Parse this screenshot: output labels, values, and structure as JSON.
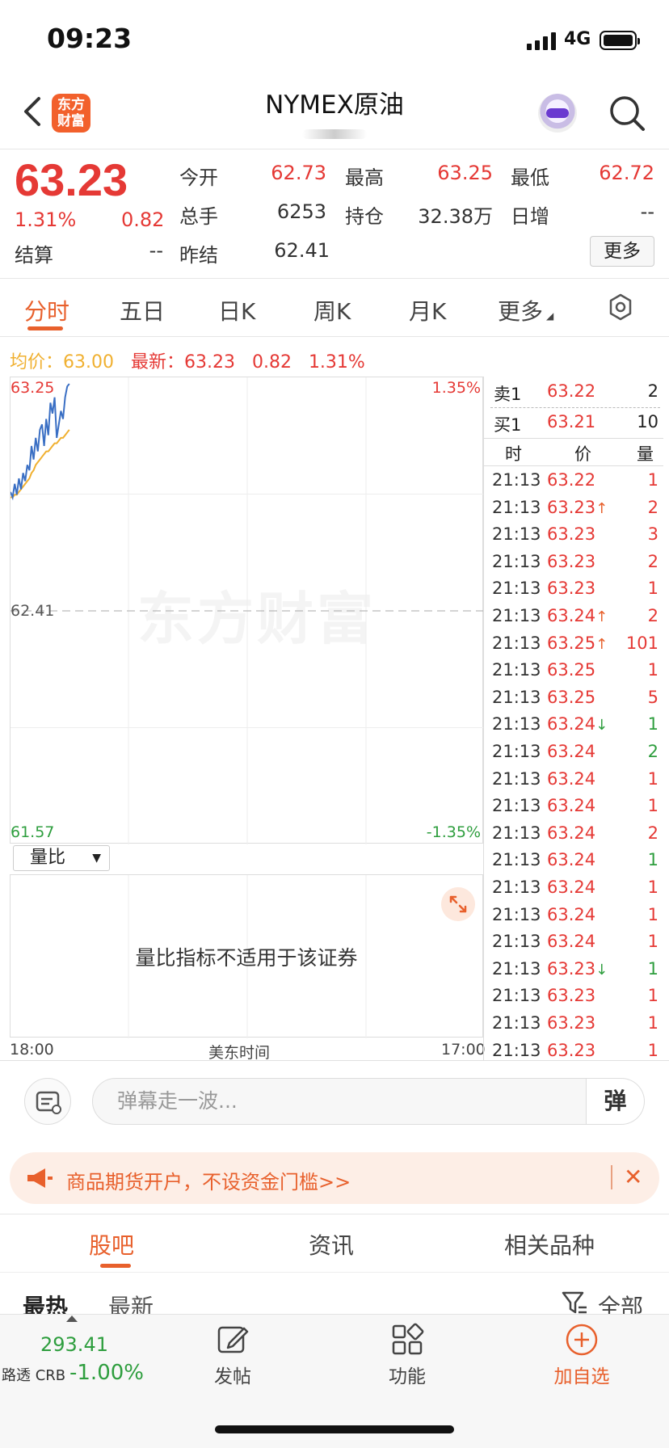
{
  "status": {
    "time": "09:23",
    "network": "4G"
  },
  "header": {
    "title": "NYMEX原油",
    "logo_text_line1": "东方",
    "logo_text_line2": "财富"
  },
  "quote": {
    "price": "63.23",
    "change_pct": "1.31%",
    "change": "0.82",
    "fields": [
      {
        "label": "今开",
        "value": "62.73",
        "color": "#e53935"
      },
      {
        "label": "最高",
        "value": "63.25",
        "color": "#e53935"
      },
      {
        "label": "最低",
        "value": "62.72",
        "color": "#e53935"
      },
      {
        "label": "总手",
        "value": "6253",
        "color": "#333333"
      },
      {
        "label": "持仓",
        "value": "32.38万",
        "color": "#333333"
      },
      {
        "label": "日增",
        "value": "--",
        "color": "#333333"
      },
      {
        "label": "结算",
        "value": "--",
        "color": "#333333"
      },
      {
        "label": "昨结",
        "value": "62.41",
        "color": "#333333"
      }
    ],
    "more_label": "更多"
  },
  "tabs": [
    {
      "label": "分时",
      "active": true
    },
    {
      "label": "五日",
      "active": false
    },
    {
      "label": "日K",
      "active": false
    },
    {
      "label": "周K",
      "active": false
    },
    {
      "label": "月K",
      "active": false
    },
    {
      "label": "更多",
      "active": false
    }
  ],
  "avg_line": {
    "avg_label": "均价：",
    "avg_value": "63.00",
    "latest_label": "最新：",
    "latest_value": "63.23",
    "latest_change": "0.82",
    "latest_pct": "1.31%"
  },
  "chart_data": {
    "type": "line",
    "y_top": "63.25",
    "y_mid": "62.41",
    "y_bottom": "61.57",
    "pct_top": "1.35%",
    "pct_bottom": "-1.35%",
    "ylim": [
      61.57,
      63.25
    ],
    "x_start": "18:00",
    "x_end": "17:00",
    "x_label": "美东时间",
    "watermark": "东方财富",
    "series": [
      {
        "name": "price",
        "color": "#3a6fc4",
        "values": [
          62.85,
          62.83,
          62.88,
          62.84,
          62.9,
          62.86,
          62.92,
          62.89,
          62.95,
          62.93,
          63.02,
          62.97,
          63.05,
          63.0,
          63.08,
          63.1,
          63.02,
          63.12,
          63.06,
          63.18,
          63.14,
          63.2,
          63.05,
          63.1,
          63.15,
          63.12,
          63.2,
          63.24,
          63.25
        ]
      },
      {
        "name": "avg",
        "color": "#f0b030",
        "values": [
          62.83,
          62.83,
          62.84,
          62.84,
          62.85,
          62.86,
          62.87,
          62.88,
          62.89,
          62.9,
          62.92,
          62.93,
          62.95,
          62.96,
          62.97,
          62.98,
          62.99,
          63.0,
          63.0,
          63.01,
          63.02,
          63.03,
          63.03,
          63.04,
          63.05,
          63.05,
          63.06,
          63.07,
          63.08
        ]
      }
    ]
  },
  "volume_ratio": {
    "select_label": "量比",
    "message": "量比指标不适用于该证券"
  },
  "order_book": {
    "sell": {
      "label": "卖1",
      "price": "63.22",
      "qty": "2"
    },
    "buy": {
      "label": "买1",
      "price": "63.21",
      "qty": "10"
    },
    "headers": [
      "时",
      "价",
      "量"
    ]
  },
  "trades": [
    {
      "time": "21:13",
      "price": "63.22",
      "arrow": "",
      "qty": "1",
      "qty_color": "#e53935"
    },
    {
      "time": "21:13",
      "price": "63.23",
      "arrow": "↑",
      "qty": "2",
      "qty_color": "#e53935"
    },
    {
      "time": "21:13",
      "price": "63.23",
      "arrow": "",
      "qty": "3",
      "qty_color": "#e53935"
    },
    {
      "time": "21:13",
      "price": "63.23",
      "arrow": "",
      "qty": "2",
      "qty_color": "#e53935"
    },
    {
      "time": "21:13",
      "price": "63.23",
      "arrow": "",
      "qty": "1",
      "qty_color": "#e53935"
    },
    {
      "time": "21:13",
      "price": "63.24",
      "arrow": "↑",
      "qty": "2",
      "qty_color": "#e53935"
    },
    {
      "time": "21:13",
      "price": "63.25",
      "arrow": "↑",
      "qty": "101",
      "qty_color": "#e53935"
    },
    {
      "time": "21:13",
      "price": "63.25",
      "arrow": "",
      "qty": "1",
      "qty_color": "#e53935"
    },
    {
      "time": "21:13",
      "price": "63.25",
      "arrow": "",
      "qty": "5",
      "qty_color": "#e53935"
    },
    {
      "time": "21:13",
      "price": "63.24",
      "arrow": "↓",
      "qty": "1",
      "qty_color": "#2e9e3e"
    },
    {
      "time": "21:13",
      "price": "63.24",
      "arrow": "",
      "qty": "2",
      "qty_color": "#2e9e3e"
    },
    {
      "time": "21:13",
      "price": "63.24",
      "arrow": "",
      "qty": "1",
      "qty_color": "#e53935"
    },
    {
      "time": "21:13",
      "price": "63.24",
      "arrow": "",
      "qty": "1",
      "qty_color": "#e53935"
    },
    {
      "time": "21:13",
      "price": "63.24",
      "arrow": "",
      "qty": "2",
      "qty_color": "#e53935"
    },
    {
      "time": "21:13",
      "price": "63.24",
      "arrow": "",
      "qty": "1",
      "qty_color": "#2e9e3e"
    },
    {
      "time": "21:13",
      "price": "63.24",
      "arrow": "",
      "qty": "1",
      "qty_color": "#e53935"
    },
    {
      "time": "21:13",
      "price": "63.24",
      "arrow": "",
      "qty": "1",
      "qty_color": "#e53935"
    },
    {
      "time": "21:13",
      "price": "63.24",
      "arrow": "",
      "qty": "1",
      "qty_color": "#e53935"
    },
    {
      "time": "21:13",
      "price": "63.23",
      "arrow": "↓",
      "qty": "1",
      "qty_color": "#2e9e3e"
    },
    {
      "time": "21:13",
      "price": "63.23",
      "arrow": "",
      "qty": "1",
      "qty_color": "#e53935"
    },
    {
      "time": "21:13",
      "price": "63.23",
      "arrow": "",
      "qty": "1",
      "qty_color": "#e53935"
    },
    {
      "time": "21:13",
      "price": "63.23",
      "arrow": "",
      "qty": "1",
      "qty_color": "#e53935"
    }
  ],
  "danmu": {
    "placeholder": "弹幕走一波...",
    "button": "弹"
  },
  "promo": {
    "text": "商品期货开户，不设资金门槛>>"
  },
  "bottom_tabs": [
    "股吧",
    "资讯",
    "相关品种"
  ],
  "feed_filter": {
    "hot": "最热",
    "newest": "最新",
    "all": "全部"
  },
  "crb": {
    "value": "293.41",
    "name": "路透 CRB",
    "change": "-1.00%"
  },
  "nav": [
    {
      "label": "发帖",
      "icon": "edit-icon"
    },
    {
      "label": "功能",
      "icon": "grid-icon"
    },
    {
      "label": "加自选",
      "icon": "add-circle-icon"
    }
  ]
}
